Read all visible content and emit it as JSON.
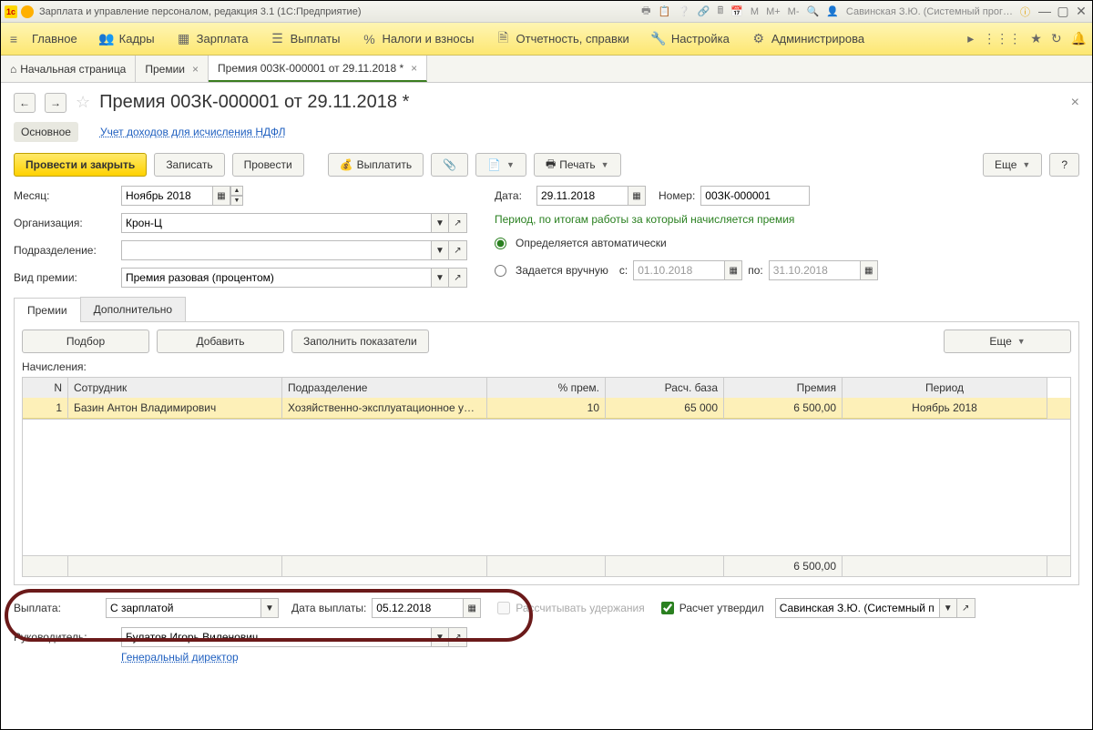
{
  "titleBar": {
    "text": "Зарплата и управление персоналом, редакция 3.1  (1С:Предприятие)",
    "user": "Савинская З.Ю. (Системный прог…",
    "m_labels": [
      "M",
      "M+",
      "M-"
    ]
  },
  "mainNav": {
    "items": [
      "Главное",
      "Кадры",
      "Зарплата",
      "Выплаты",
      "Налоги и взносы",
      "Отчетность, справки",
      "Настройка",
      "Администрирова"
    ]
  },
  "tabs": {
    "home": "Начальная страница",
    "list": "Премии",
    "doc": "Премия 00ЗК-000001 от 29.11.2018 *"
  },
  "header": {
    "title": "Премия 00ЗК-000001 от 29.11.2018 *"
  },
  "subNav": {
    "main": "Основное",
    "link": "Учет доходов для исчисления НДФЛ"
  },
  "toolbar": {
    "post_close": "Провести и закрыть",
    "save": "Записать",
    "post": "Провести",
    "pay": "Выплатить",
    "print": "Печать",
    "more": "Еще"
  },
  "form": {
    "month_label": "Месяц:",
    "month_value": "Ноябрь 2018",
    "org_label": "Организация:",
    "org_value": "Крон-Ц",
    "dep_label": "Подразделение:",
    "dep_value": "",
    "type_label": "Вид премии:",
    "type_value": "Премия разовая (процентом)",
    "date_label": "Дата:",
    "date_value": "29.11.2018",
    "num_label": "Номер:",
    "num_value": "00ЗК-000001",
    "period_title": "Период, по итогам работы за который начисляется премия",
    "radio_auto": "Определяется автоматически",
    "radio_manual": "Задается вручную",
    "period_from_label": "с:",
    "period_from": "01.10.2018",
    "period_to_label": "по:",
    "period_to": "31.10.2018"
  },
  "innerTabs": {
    "prem": "Премии",
    "extra": "Дополнительно"
  },
  "panel": {
    "pick": "Подбор",
    "add": "Добавить",
    "fill": "Заполнить показатели",
    "more": "Еще",
    "section": "Начисления:"
  },
  "table": {
    "headers": {
      "n": "N",
      "emp": "Сотрудник",
      "dep": "Подразделение",
      "pct": "% прем.",
      "base": "Расч. база",
      "prem": "Премия",
      "per": "Период"
    },
    "row": {
      "n": "1",
      "emp": "Базин Антон Владимирович",
      "dep": "Хозяйственно-эксплуатационное у…",
      "pct": "10",
      "base": "65 000",
      "prem": "6 500,00",
      "per": "Ноябрь 2018"
    },
    "total_prem": "6 500,00"
  },
  "bottom": {
    "payout_label": "Выплата:",
    "payout_value": "С зарплатой",
    "paydate_label": "Дата выплаты:",
    "paydate_value": "05.12.2018",
    "calc_ded": "Рассчитывать удержания",
    "approved": "Расчет утвердил",
    "approver": "Савинская З.Ю. (Системный п",
    "head_label": "Руководитель:",
    "head_value": "Булатов Игорь Виленович",
    "head_title": "Генеральный директор"
  }
}
